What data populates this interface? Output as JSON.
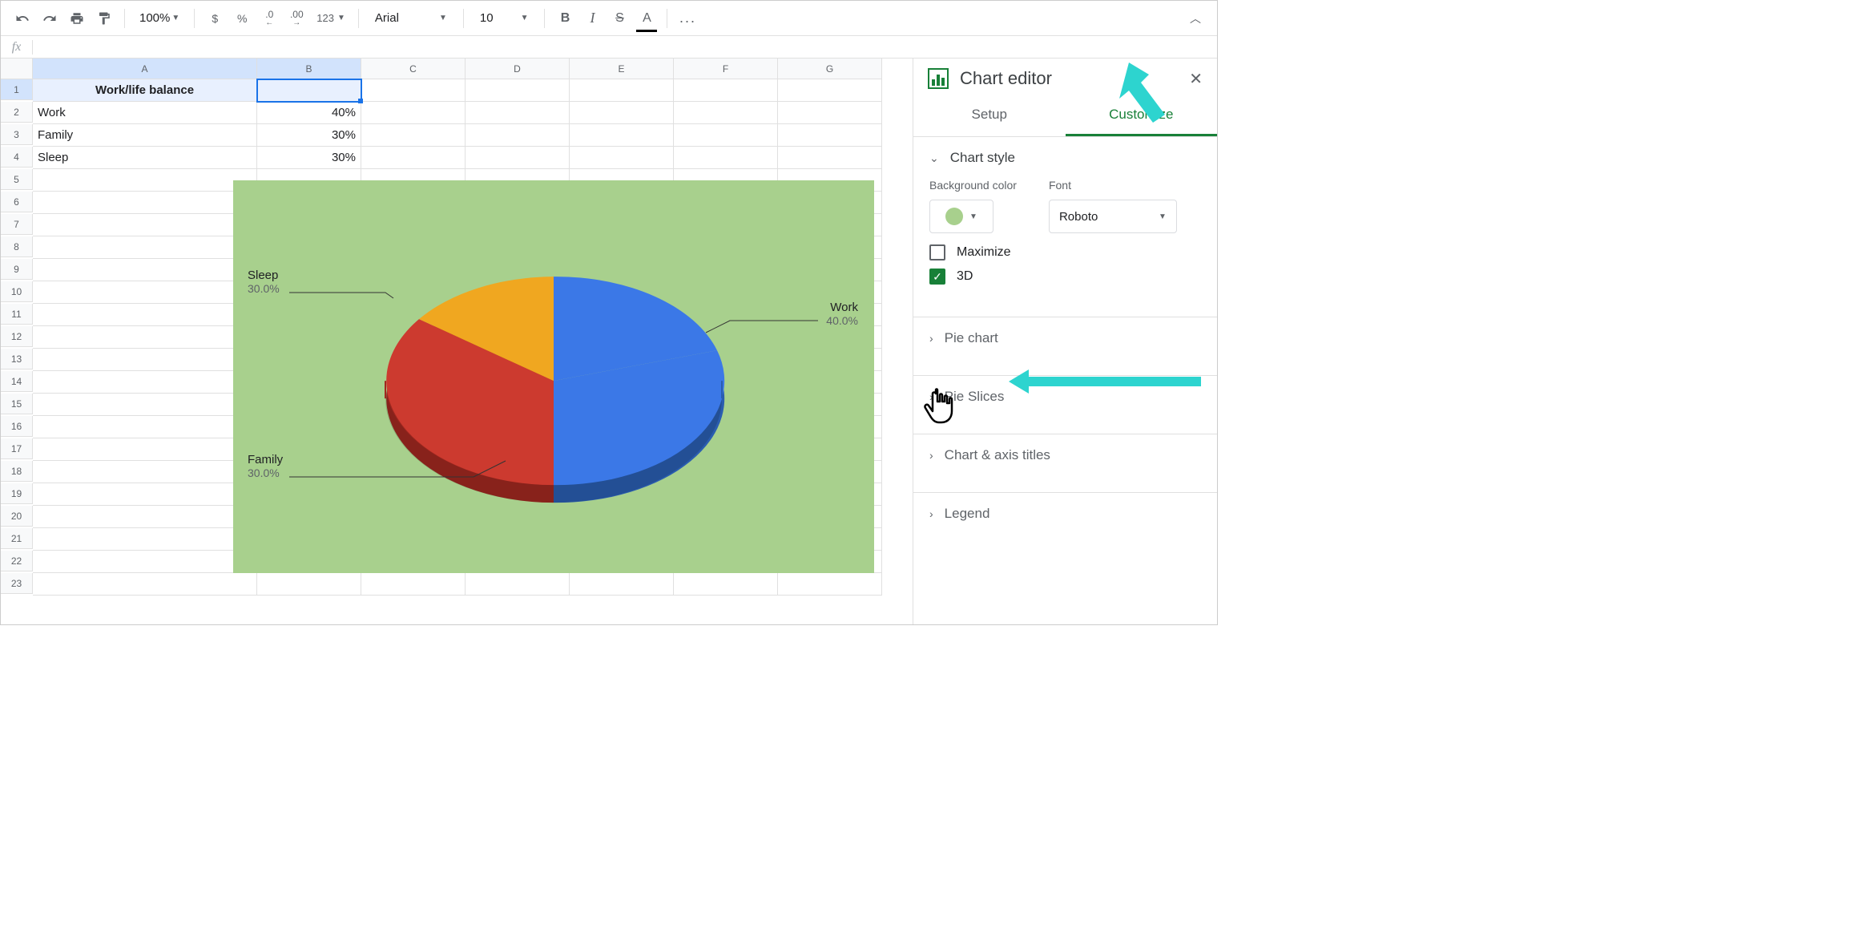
{
  "toolbar": {
    "zoom": "100%",
    "currency": "$",
    "percent": "%",
    "dec_less": ".0",
    "dec_more": ".00",
    "fmt": "123",
    "font": "Arial",
    "size": "10",
    "bold": "B",
    "italic": "I",
    "strike": "S",
    "textcolor": "A",
    "more": "..."
  },
  "grid": {
    "cols": [
      "A",
      "B",
      "C",
      "D",
      "E",
      "F",
      "G"
    ],
    "rows": [
      "1",
      "2",
      "3",
      "4",
      "5",
      "6",
      "7",
      "8",
      "9",
      "10",
      "11",
      "12",
      "13",
      "14",
      "15",
      "16",
      "17",
      "18",
      "19",
      "20",
      "21",
      "22",
      "23"
    ],
    "a1": "Work/life balance",
    "a2": "Work",
    "b2": "40%",
    "a3": "Family",
    "b3": "30%",
    "a4": "Sleep",
    "b4": "30%"
  },
  "chart_data": {
    "type": "pie",
    "title": "Work/life balance",
    "colors": {
      "Work": "#3b78e7",
      "Family": "#cc3a2f",
      "Sleep": "#f0a720"
    },
    "background": "#a8d08d",
    "series": [
      {
        "name": "Work",
        "values": [
          40
        ],
        "percent": 40.0
      },
      {
        "name": "Family",
        "values": [
          30
        ],
        "percent": 30.0
      },
      {
        "name": "Sleep",
        "values": [
          30
        ],
        "percent": 30.0
      }
    ],
    "is_3d": true
  },
  "labels": {
    "work": "Work",
    "work_pct": "40.0%",
    "family": "Family",
    "family_pct": "30.0%",
    "sleep": "Sleep",
    "sleep_pct": "30.0%"
  },
  "panel": {
    "title": "Chart editor",
    "tab_setup": "Setup",
    "tab_customize": "Customize",
    "section_style": "Chart style",
    "bg_label": "Background color",
    "font_label": "Font",
    "font_value": "Roboto",
    "cb_maximize": "Maximize",
    "cb_3d": "3D",
    "section_pie": "Pie chart",
    "section_slices": "Pie Slices",
    "section_axis": "Chart & axis titles",
    "section_legend": "Legend"
  }
}
